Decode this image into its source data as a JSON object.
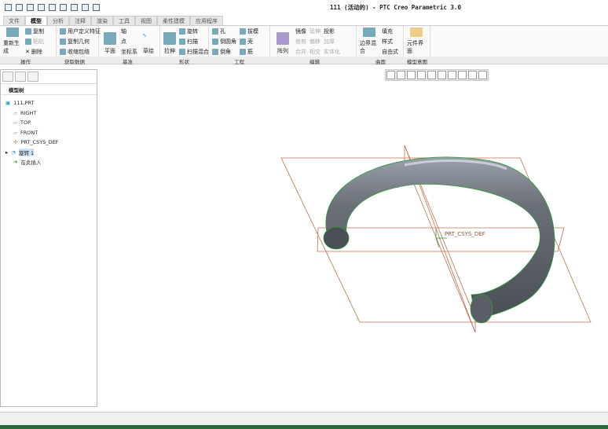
{
  "window": {
    "title": "111 (活动的) - PTC Creo Parametric 3.0"
  },
  "tabs": [
    "文件",
    "模型",
    "分析",
    "注释",
    "渲染",
    "工具",
    "视图",
    "柔性建模",
    "应用程序"
  ],
  "active_tab": "模型",
  "ribbon": {
    "operations": {
      "label": "操作",
      "big": "重新生成",
      "items": [
        "复制",
        "粘贴",
        "删除"
      ]
    },
    "get_data": {
      "label": "获取数据",
      "items": [
        "用户定义特征",
        "复制几何",
        "收缩包络"
      ]
    },
    "datum": {
      "label": "基准",
      "big": "平面",
      "items": [
        "轴",
        "点",
        "坐标系"
      ],
      "big2": "草绘"
    },
    "shapes": {
      "label": "形状",
      "big": "拉伸",
      "items": [
        "旋转",
        "扫描",
        "扫描混合"
      ]
    },
    "engineering": {
      "label": "工程",
      "items": [
        "孔",
        "倒圆角",
        "倒角",
        "拔模",
        "壳",
        "筋"
      ]
    },
    "editing": {
      "label": "编辑",
      "big": "阵列",
      "items": [
        "镜像",
        "修剪",
        "合并",
        "延伸",
        "偏移",
        "相交",
        "投影",
        "加厚",
        "实体化"
      ]
    },
    "surfaces": {
      "label": "曲面",
      "big": "边界混合",
      "items": [
        "填充",
        "样式",
        "自由式"
      ]
    },
    "model_intent": {
      "label": "模型意图",
      "big": "元件界面"
    }
  },
  "model_tree": {
    "header": "模型树",
    "items": [
      {
        "label": "111.PRT"
      },
      {
        "label": "RIGHT"
      },
      {
        "label": "TOP"
      },
      {
        "label": "FRONT"
      },
      {
        "label": "PRT_CSYS_DEF"
      },
      {
        "label": "旋转 1",
        "selected": true
      },
      {
        "label": "在此插入"
      }
    ]
  },
  "viewport": {
    "csys_label": "PRT_CSYS_DEF",
    "datum_color": "#c07050",
    "model_color": "#6a6f78",
    "edge_color": "#2c9c3c"
  }
}
